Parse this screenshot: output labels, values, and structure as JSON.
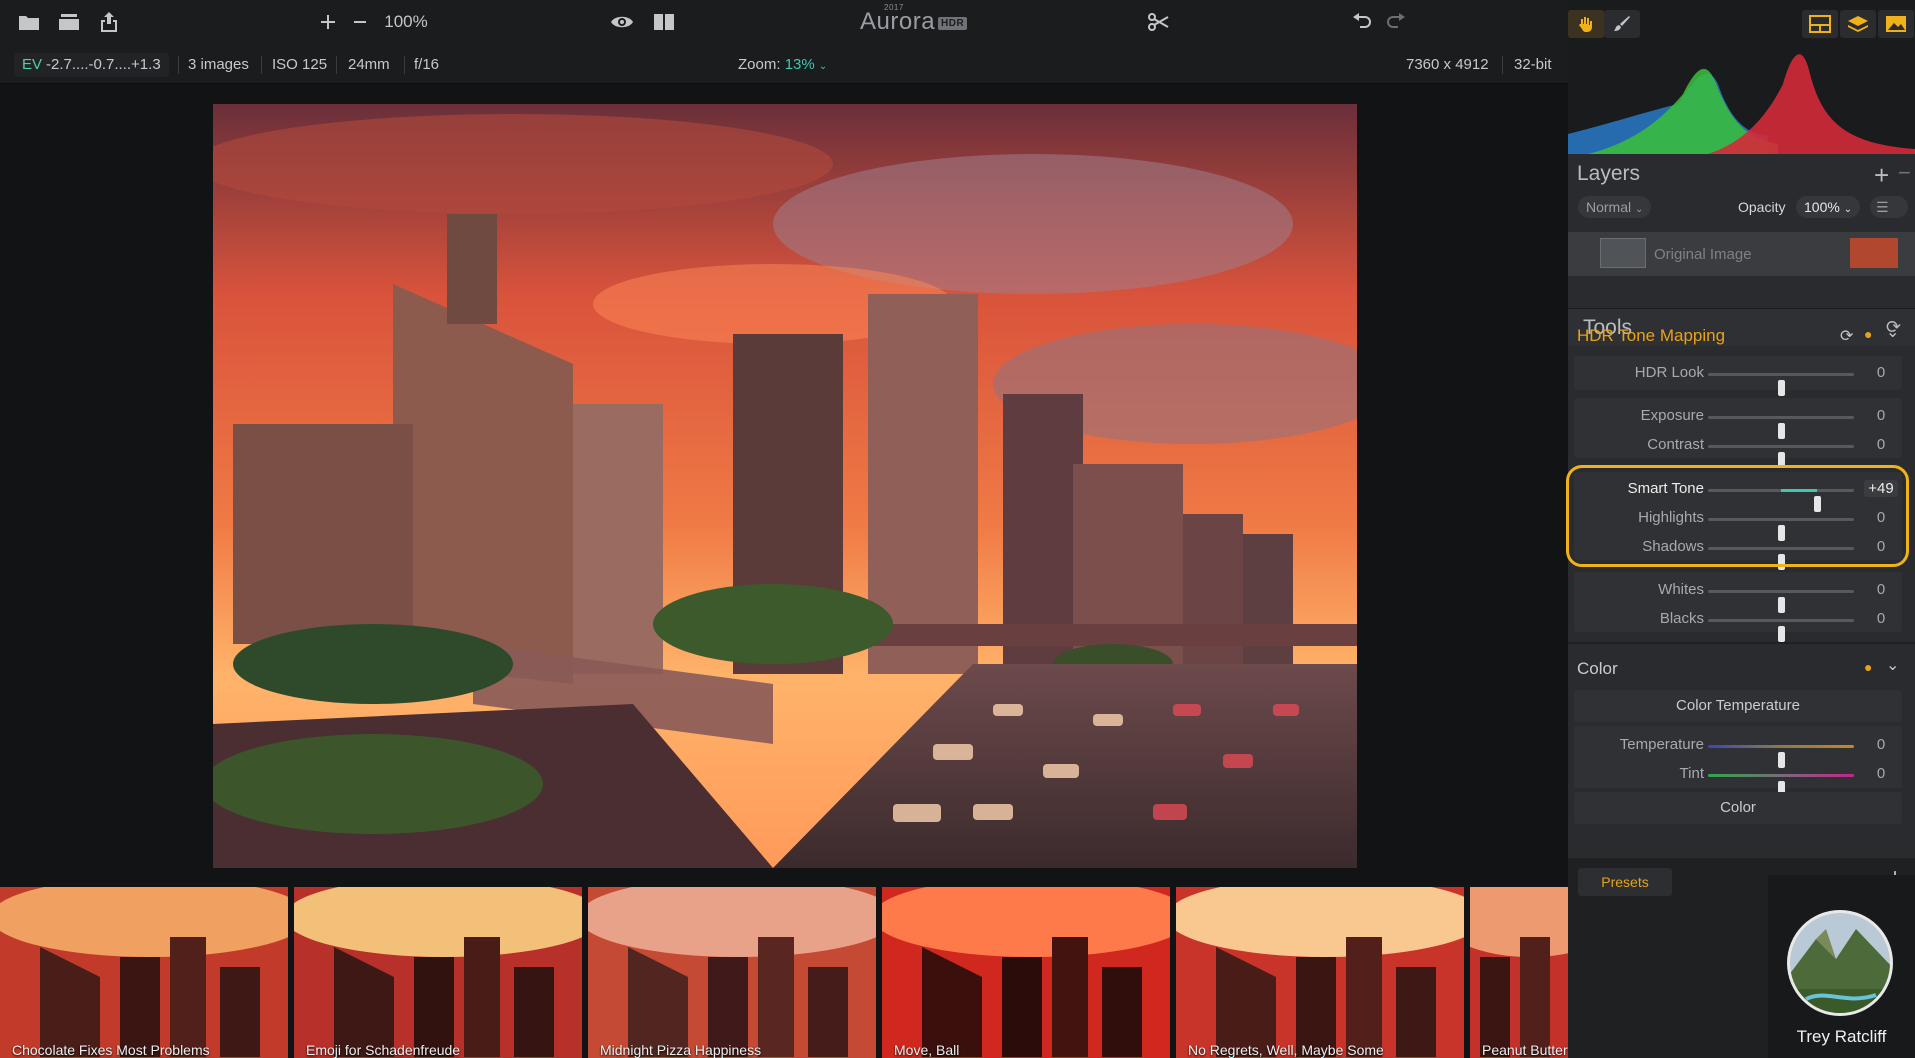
{
  "toolbar": {
    "zoom_level": "100%",
    "brand": "Aurora",
    "brand_badge": "HDR",
    "brand_year": "2017"
  },
  "infobar": {
    "ev_label": "EV",
    "ev_value": "-2.7....-0.7....+1.3",
    "images": "3 images",
    "iso": "ISO 125",
    "focal": "24mm",
    "aperture": "f/16",
    "zoom_label": "Zoom:",
    "zoom_value": "13%",
    "dimensions": "7360 x 4912",
    "bit_depth": "32-bit"
  },
  "layers": {
    "title": "Layers",
    "blend_mode": "Normal",
    "opacity_label": "Opacity",
    "opacity_value": "100%",
    "layer_name": "Original Image"
  },
  "tools": {
    "title": "Tools",
    "hdr_tone_mapping": {
      "title": "HDR Tone Mapping",
      "sliders": [
        {
          "label": "HDR Look",
          "value": "0",
          "pos": 0.5
        },
        {
          "label": "Exposure",
          "value": "0",
          "pos": 0.5
        },
        {
          "label": "Contrast",
          "value": "0",
          "pos": 0.5
        },
        {
          "label": "Smart Tone",
          "value": "+49",
          "pos": 0.745
        },
        {
          "label": "Highlights",
          "value": "0",
          "pos": 0.5
        },
        {
          "label": "Shadows",
          "value": "0",
          "pos": 0.5
        },
        {
          "label": "Whites",
          "value": "0",
          "pos": 0.5
        },
        {
          "label": "Blacks",
          "value": "0",
          "pos": 0.5
        }
      ]
    },
    "color": {
      "title": "Color",
      "sub_temperature": "Color Temperature",
      "sliders": [
        {
          "label": "Temperature",
          "value": "0",
          "pos": 0.5
        },
        {
          "label": "Tint",
          "value": "0",
          "pos": 0.5
        }
      ],
      "sub_color": "Color"
    },
    "presets_label": "Presets"
  },
  "filmstrip": {
    "presets": [
      "Chocolate Fixes Most Problems",
      "Emoji for Schadenfreude",
      "Midnight Pizza Happiness",
      "Move, Ball",
      "No Regrets, Well, Maybe Some",
      "Peanut Butter Blowout"
    ],
    "author_name": "Trey Ratcliff"
  },
  "colors": {
    "accent_orange": "#f0b21a",
    "accent_teal": "#3fc7b0"
  }
}
